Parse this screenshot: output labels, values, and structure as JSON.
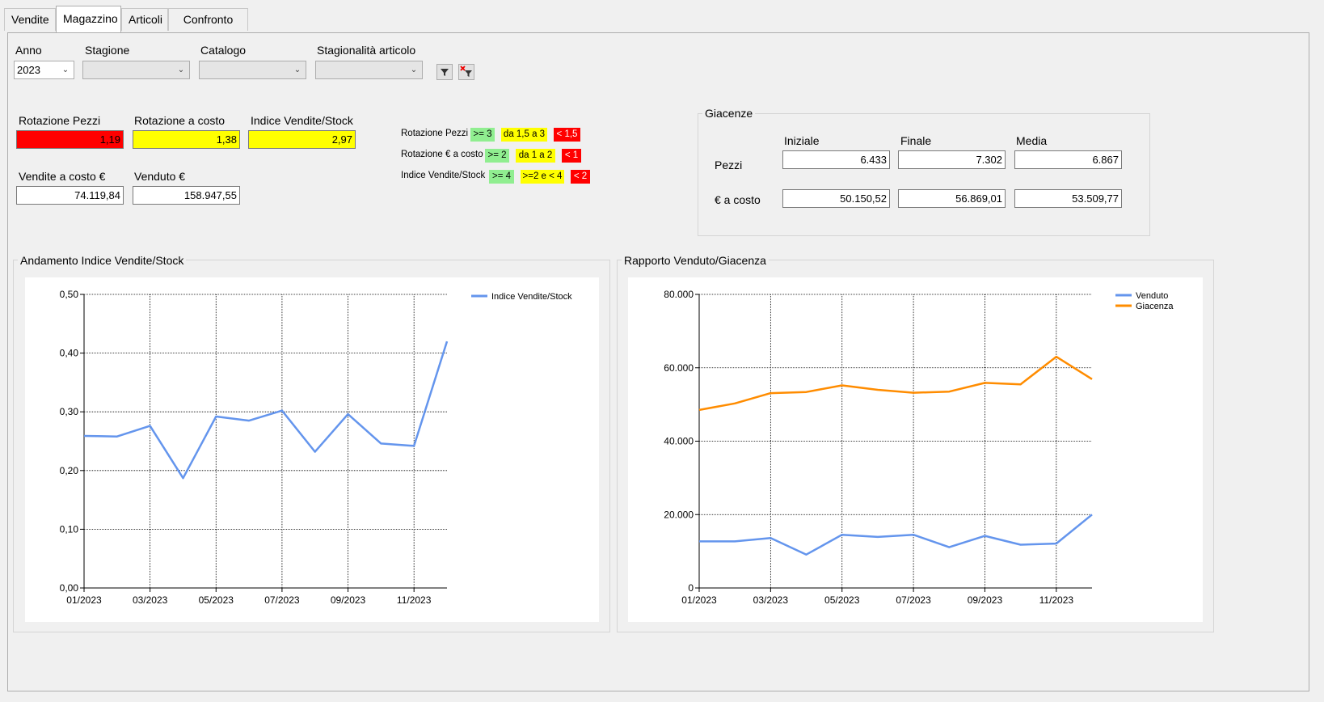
{
  "tabs": [
    {
      "label": "Vendite",
      "active": false
    },
    {
      "label": "Magazzino",
      "active": true
    },
    {
      "label": "Articoli",
      "active": false
    },
    {
      "label": "Confronto Anni",
      "active": false
    }
  ],
  "filters": {
    "anno_label": "Anno",
    "anno_value": "2023",
    "stagione_label": "Stagione",
    "stagione_value": "",
    "catalogo_label": "Catalogo",
    "catalogo_value": "",
    "stagionalita_label": "Stagionalità articolo",
    "stagionalita_value": "",
    "filter_icon": "filter-icon",
    "clear_filter_icon": "clear-filter-icon"
  },
  "kpi": {
    "rotazione_pezzi_label": "Rotazione Pezzi",
    "rotazione_pezzi": "1,19",
    "rotazione_costo_label": "Rotazione a costo",
    "rotazione_costo": "1,38",
    "indice_label": "Indice Vendite/Stock",
    "indice": "2,97",
    "vendite_costo_label": "Vendite a costo €",
    "vendite_costo": "74.119,84",
    "venduto_label": "Venduto €",
    "venduto": "158.947,55"
  },
  "thresholds": [
    {
      "label": "Rotazione Pezzi",
      "green": ">= 3",
      "yellow": "da 1,5 a 3",
      "red": "< 1,5"
    },
    {
      "label": "Rotazione € a costo",
      "green": ">= 2",
      "yellow": "da 1 a 2",
      "red": "< 1"
    },
    {
      "label": "Indice Vendite/Stock",
      "green": ">= 4",
      "yellow": ">=2 e < 4",
      "red": "< 2"
    }
  ],
  "colors": {
    "green": "#90ee90",
    "yellow": "#ffff00",
    "red": "#ff0000",
    "venduto": "#6495ed",
    "giacenza": "#ff8c00"
  },
  "giacenze": {
    "title": "Giacenze",
    "col_iniziale": "Iniziale",
    "col_finale": "Finale",
    "col_media": "Media",
    "row_pezzi": "Pezzi",
    "row_costo": "€ a costo",
    "pezzi": {
      "iniziale": "6.433",
      "finale": "7.302",
      "media": "6.867"
    },
    "costo": {
      "iniziale": "50.150,52",
      "finale": "56.869,01",
      "media": "53.509,77"
    }
  },
  "chart_data": [
    {
      "type": "line",
      "title": "Andamento Indice Vendite/Stock",
      "x": [
        "01/2023",
        "02/2023",
        "03/2023",
        "04/2023",
        "05/2023",
        "06/2023",
        "07/2023",
        "08/2023",
        "09/2023",
        "10/2023",
        "11/2023",
        "12/2023"
      ],
      "xtick_labels": [
        "01/2023",
        "03/2023",
        "05/2023",
        "07/2023",
        "09/2023",
        "11/2023"
      ],
      "ylim": [
        0,
        0.5
      ],
      "ytick_labels": [
        "0,00",
        "0,10",
        "0,20",
        "0,30",
        "0,40",
        "0,50"
      ],
      "series": [
        {
          "name": "Indice Vendite/Stock",
          "color": "#6495ed",
          "values": [
            0.259,
            0.258,
            0.276,
            0.187,
            0.292,
            0.285,
            0.302,
            0.232,
            0.296,
            0.246,
            0.242,
            0.42
          ]
        }
      ],
      "legend": "top-right",
      "grid": true
    },
    {
      "type": "line",
      "title": "Rapporto Venduto/Giacenza",
      "x": [
        "01/2023",
        "02/2023",
        "03/2023",
        "04/2023",
        "05/2023",
        "06/2023",
        "07/2023",
        "08/2023",
        "09/2023",
        "10/2023",
        "11/2023",
        "12/2023"
      ],
      "xtick_labels": [
        "01/2023",
        "03/2023",
        "05/2023",
        "07/2023",
        "09/2023",
        "11/2023"
      ],
      "ylim": [
        0,
        80000
      ],
      "ytick_labels": [
        "0",
        "20.000",
        "40.000",
        "60.000",
        "80.000"
      ],
      "series": [
        {
          "name": "Venduto",
          "color": "#6495ed",
          "values": [
            12700,
            12700,
            13600,
            9100,
            14500,
            13900,
            14500,
            11100,
            14200,
            11800,
            12100,
            20000
          ]
        },
        {
          "name": "Giacenza",
          "color": "#ff8c00",
          "values": [
            48500,
            50300,
            53100,
            53400,
            55200,
            54000,
            53200,
            53500,
            55900,
            55500,
            63000,
            56900
          ]
        }
      ],
      "legend": "top-right",
      "grid": true
    }
  ]
}
